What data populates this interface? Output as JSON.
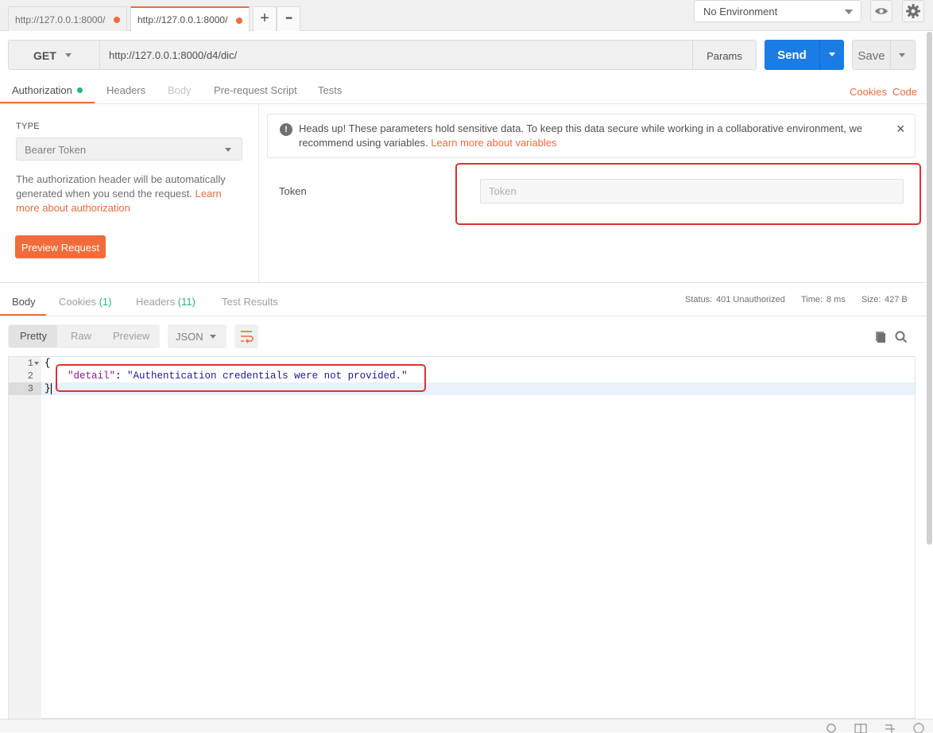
{
  "tabs": [
    {
      "label": "http://127.0.0.1:8000/",
      "active": false
    },
    {
      "label": "http://127.0.0.1:8000/",
      "active": true
    }
  ],
  "tabbar": {
    "add_label": "+",
    "more_label": "•••"
  },
  "environment": {
    "selected": "No Environment"
  },
  "request": {
    "method": "GET",
    "url": "http://127.0.0.1:8000/d4/dic/",
    "params_label": "Params",
    "send_label": "Send",
    "save_label": "Save"
  },
  "request_tabs": {
    "authorization": "Authorization",
    "headers": "Headers",
    "body": "Body",
    "prerequest": "Pre-request Script",
    "tests": "Tests",
    "cookies": "Cookies",
    "code": "Code"
  },
  "auth": {
    "type_label": "TYPE",
    "type_value": "Bearer Token",
    "desc_text": "The authorization header will be automatically generated when you send the request. ",
    "desc_link": "Learn more about authorization",
    "preview_label": "Preview Request",
    "alert_icon": "!",
    "alert_text": "Heads up! These parameters hold sensitive data. To keep this data secure while working in a collaborative environment, we recommend using variables. ",
    "alert_link": "Learn more about variables",
    "alert_close": "×",
    "token_label": "Token",
    "token_placeholder": "Token"
  },
  "response": {
    "tabs": {
      "body": "Body",
      "cookies": "Cookies",
      "cookies_count": "(1)",
      "headers": "Headers",
      "headers_count": "(11)",
      "tests": "Test Results"
    },
    "status_label": "Status:",
    "status_value": "401 Unauthorized",
    "time_label": "Time:",
    "time_value": "8 ms",
    "size_label": "Size:",
    "size_value": "427 B",
    "views": {
      "pretty": "Pretty",
      "raw": "Raw",
      "preview": "Preview"
    },
    "format": "JSON",
    "lines": [
      "1",
      "2",
      "3"
    ],
    "code": {
      "open": "{",
      "key": "\"detail\"",
      "colon": ": ",
      "value": "\"Authentication credentials were not provided.\"",
      "close": "}"
    }
  },
  "colors": {
    "accent": "#f26b3a",
    "send": "#1c7ce6",
    "success": "#26b47f",
    "annotation": "#e03131"
  },
  "icons": [
    "eye-icon",
    "gear-icon",
    "info-icon",
    "close-icon",
    "wrap-lines-icon",
    "copy-icon",
    "search-icon"
  ]
}
